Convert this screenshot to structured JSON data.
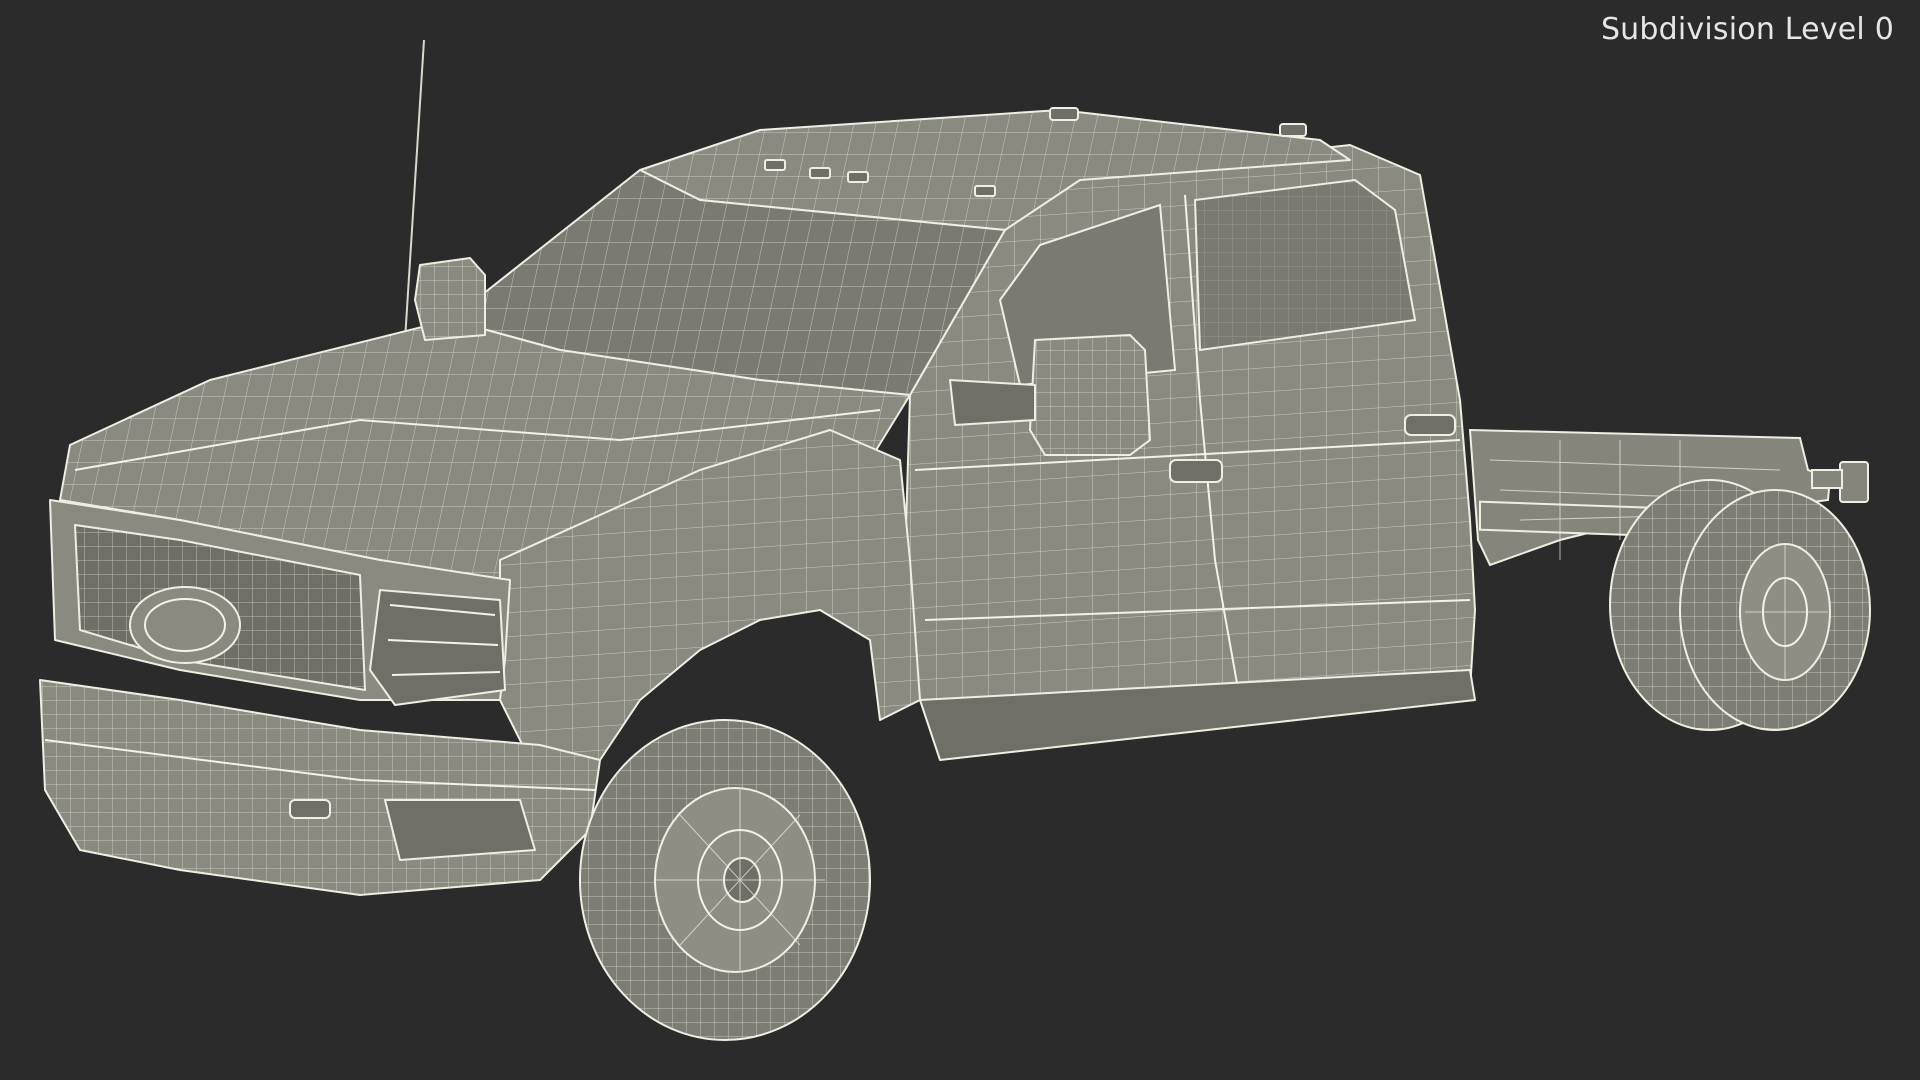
{
  "viewport": {
    "background": "#2b2b2b",
    "wire_color": "#eeeee2",
    "surface_color": "#8a8a80"
  },
  "overlay": {
    "label": "Subdivision Level 0"
  }
}
